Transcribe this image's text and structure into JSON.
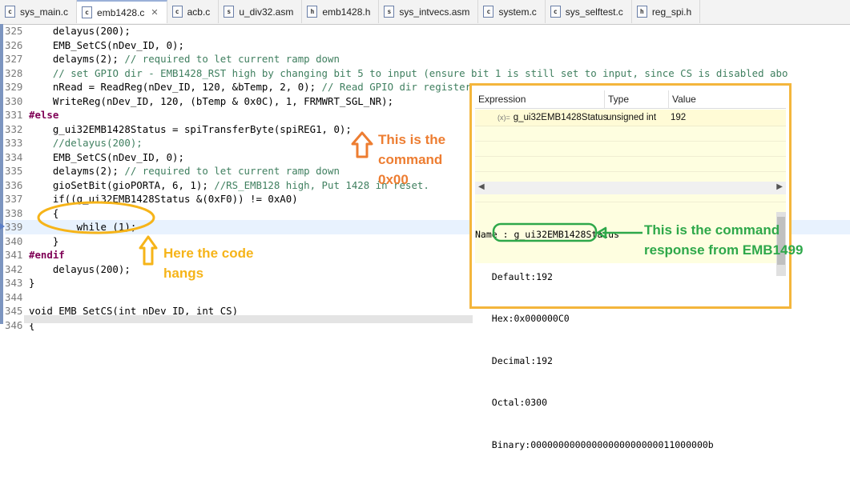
{
  "tabs": [
    {
      "icon": "c",
      "label": "sys_main.c"
    },
    {
      "icon": "c",
      "label": "emb1428.c",
      "close": "✕",
      "active": true
    },
    {
      "icon": "c",
      "label": "acb.c"
    },
    {
      "icon": "s",
      "label": "u_div32.asm"
    },
    {
      "icon": "h",
      "label": "emb1428.h"
    },
    {
      "icon": "s",
      "label": "sys_intvecs.asm"
    },
    {
      "icon": "c",
      "label": "system.c"
    },
    {
      "icon": "c",
      "label": "sys_selftest.c"
    },
    {
      "icon": "h",
      "label": "reg_spi.h"
    }
  ],
  "editor": {
    "lines": [
      {
        "n": "325",
        "code": "    delayus(200);"
      },
      {
        "n": "326",
        "code": "    EMB_SetCS(nDev_ID, 0);"
      },
      {
        "n": "327",
        "code": "    delayms(2); ",
        "comment": "// required to let current ramp down"
      },
      {
        "n": "328",
        "code": "    ",
        "comment": "// set GPIO dir - EMB1428_RST high by changing bit 5 to input (ensure bit 1 is still set to input, since CS is disabled abo"
      },
      {
        "n": "329",
        "code": "    nRead = ReadReg(nDev_ID, 120, &bTemp, 2, 0); ",
        "comment": "// Read GPIO dir register"
      },
      {
        "n": "330",
        "code": "    WriteReg(nDev_ID, 120, (bTemp & 0x0C), 1, FRMWRT_SGL_NR);"
      },
      {
        "n": "331",
        "pp": "#else",
        "code": ""
      },
      {
        "n": "332",
        "code": "    g_ui32EMB1428Status = spiTransferByte(spiREG1, 0);"
      },
      {
        "n": "333",
        "code": "    ",
        "comment": "//delayus(200);"
      },
      {
        "n": "334",
        "code": "    EMB_SetCS(nDev_ID, 0);"
      },
      {
        "n": "335",
        "code": "    delayms(2); ",
        "comment": "// required to let current ramp down"
      },
      {
        "n": "336",
        "code": "    gioSetBit(gioPORTA, 6, 1); ",
        "comment": "//RS_EMB128 high, Put 1428 in reset."
      },
      {
        "n": "337",
        "code": "    if((g_ui32EMB1428Status &(0xF0)) != 0xA0)"
      },
      {
        "n": "338",
        "code": "    {"
      },
      {
        "n": "339",
        "code": "        while (1);",
        "highlight": true
      },
      {
        "n": "340",
        "code": "    }"
      },
      {
        "n": "341",
        "pp": "#endif",
        "code": ""
      },
      {
        "n": "342",
        "code": "    delayus(200);"
      },
      {
        "n": "343",
        "code": "}"
      },
      {
        "n": "344",
        "code": ""
      },
      {
        "n": "345",
        "code": "void EMB_SetCS(int nDev_ID, int CS)"
      },
      {
        "n": "346",
        "code": "{"
      }
    ]
  },
  "expressions": {
    "headers": {
      "expression": "Expression",
      "type": "Type",
      "value": "Value"
    },
    "row": {
      "icon": "(x)=",
      "name": "g_ui32EMB1428Status",
      "type": "unsigned int",
      "value": "192"
    },
    "scroll_left": "◀",
    "scroll_right": "▶",
    "detail": {
      "name": "Name : g_ui32EMB1428Status",
      "default": "   Default:192",
      "hex": "   Hex:0x000000C0",
      "decimal": "   Decimal:192",
      "octal": "   Octal:0300",
      "binary": "   Binary:00000000000000000000000011000000b"
    }
  },
  "annotations": {
    "command": [
      "This is the",
      "command",
      "0x00"
    ],
    "hangs": [
      "Here the code",
      "hangs"
    ],
    "response": [
      "This is the command",
      "response from EMB1499"
    ]
  },
  "colors": {
    "orange": "#ed7d31",
    "yellow": "#f6b419",
    "green": "#2ea84a",
    "frame": "#f4b63c"
  }
}
